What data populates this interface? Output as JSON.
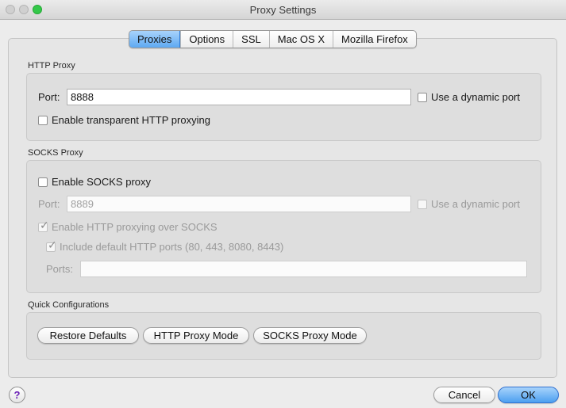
{
  "window": {
    "title": "Proxy Settings"
  },
  "tabs": [
    {
      "label": "Proxies",
      "active": true
    },
    {
      "label": "Options"
    },
    {
      "label": "SSL"
    },
    {
      "label": "Mac OS X"
    },
    {
      "label": "Mozilla Firefox"
    }
  ],
  "http_proxy": {
    "section_label": "HTTP Proxy",
    "port_label": "Port:",
    "port_value": "8888",
    "dynamic_port_label": "Use a dynamic port",
    "dynamic_port_checked": false,
    "transparent_label": "Enable transparent HTTP proxying",
    "transparent_checked": false
  },
  "socks_proxy": {
    "section_label": "SOCKS Proxy",
    "enable_label": "Enable SOCKS proxy",
    "enable_checked": false,
    "port_label": "Port:",
    "port_value": "8889",
    "dynamic_port_label": "Use a dynamic port",
    "http_over_socks_label": "Enable HTTP proxying over SOCKS",
    "http_over_socks_checked": true,
    "include_default_ports_label": "Include default HTTP ports (80, 443, 8080, 8443)",
    "include_default_ports_checked": true,
    "ports_label": "Ports:",
    "ports_value": ""
  },
  "quick_config": {
    "section_label": "Quick Configurations",
    "restore_label": "Restore Defaults",
    "http_mode_label": "HTTP Proxy Mode",
    "socks_mode_label": "SOCKS Proxy Mode"
  },
  "footer": {
    "help_label": "?",
    "cancel_label": "Cancel",
    "ok_label": "OK"
  },
  "colors": {
    "accent": "#5ea9f2",
    "close_button": "#34c84a",
    "help_glyph": "#6a1fb5"
  }
}
